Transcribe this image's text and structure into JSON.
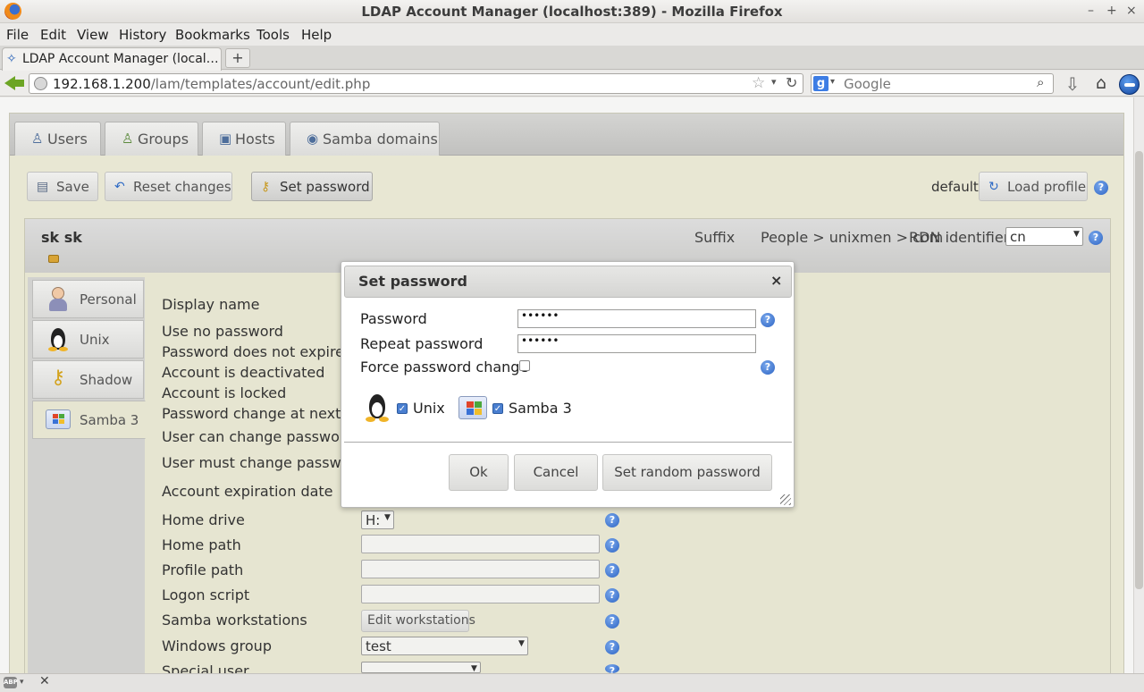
{
  "window": {
    "title": "LDAP Account Manager (localhost:389) - Mozilla Firefox",
    "controls": [
      "–",
      "+",
      "×"
    ]
  },
  "menu": [
    "File",
    "Edit",
    "View",
    "History",
    "Bookmarks",
    "Tools",
    "Help"
  ],
  "browser_tab": {
    "label": "LDAP Account Manager (local…",
    "new_tab": "+"
  },
  "address": {
    "host": "192.168.1.200",
    "path": "/lam/templates/account/edit.php"
  },
  "search": {
    "placeholder": "Google"
  },
  "lam_tabs": [
    "Users",
    "Groups",
    "Hosts",
    "Samba domains"
  ],
  "toolbar": {
    "save": "Save",
    "reset": "Reset changes",
    "set_password": "Set password",
    "profile_name": "default",
    "load_profile": "Load profile"
  },
  "account": {
    "title": "sk sk",
    "suffix_label": "Suffix",
    "suffix_value": "People > unixmen > com",
    "rdn_label": "RDN identifier",
    "rdn_value": "cn"
  },
  "side_tabs": [
    "Personal",
    "Unix",
    "Shadow",
    "Samba 3"
  ],
  "form": {
    "labels": [
      "Display name",
      "Use no password",
      "Password does not expire",
      "Account is deactivated",
      "Account is locked",
      "Password change at next log",
      "User can change password",
      "User must change password",
      "Account expiration date",
      "Home drive",
      "Home path",
      "Profile path",
      "Logon script",
      "Samba workstations",
      "Windows group",
      "Special user"
    ],
    "home_drive": "H:",
    "edit_workstations": "Edit workstations",
    "windows_group": "test"
  },
  "dialog": {
    "title": "Set password",
    "close": "×",
    "password_label": "Password",
    "password_value": "••••••",
    "repeat_label": "Repeat password",
    "repeat_value": "••••••",
    "force_label": "Force password change",
    "force_checked": false,
    "modules": [
      {
        "name": "Unix",
        "checked": true,
        "icon": "tux-icon"
      },
      {
        "name": "Samba 3",
        "checked": true,
        "icon": "windows-icon"
      }
    ],
    "ok": "Ok",
    "cancel": "Cancel",
    "random": "Set random password"
  },
  "statusbar": {
    "abp": "ABP",
    "close": "✕"
  },
  "colors": {
    "panel_bg": "#e6e5d1",
    "help_blue": "#2d64c4",
    "back_green": "#6ca524"
  }
}
